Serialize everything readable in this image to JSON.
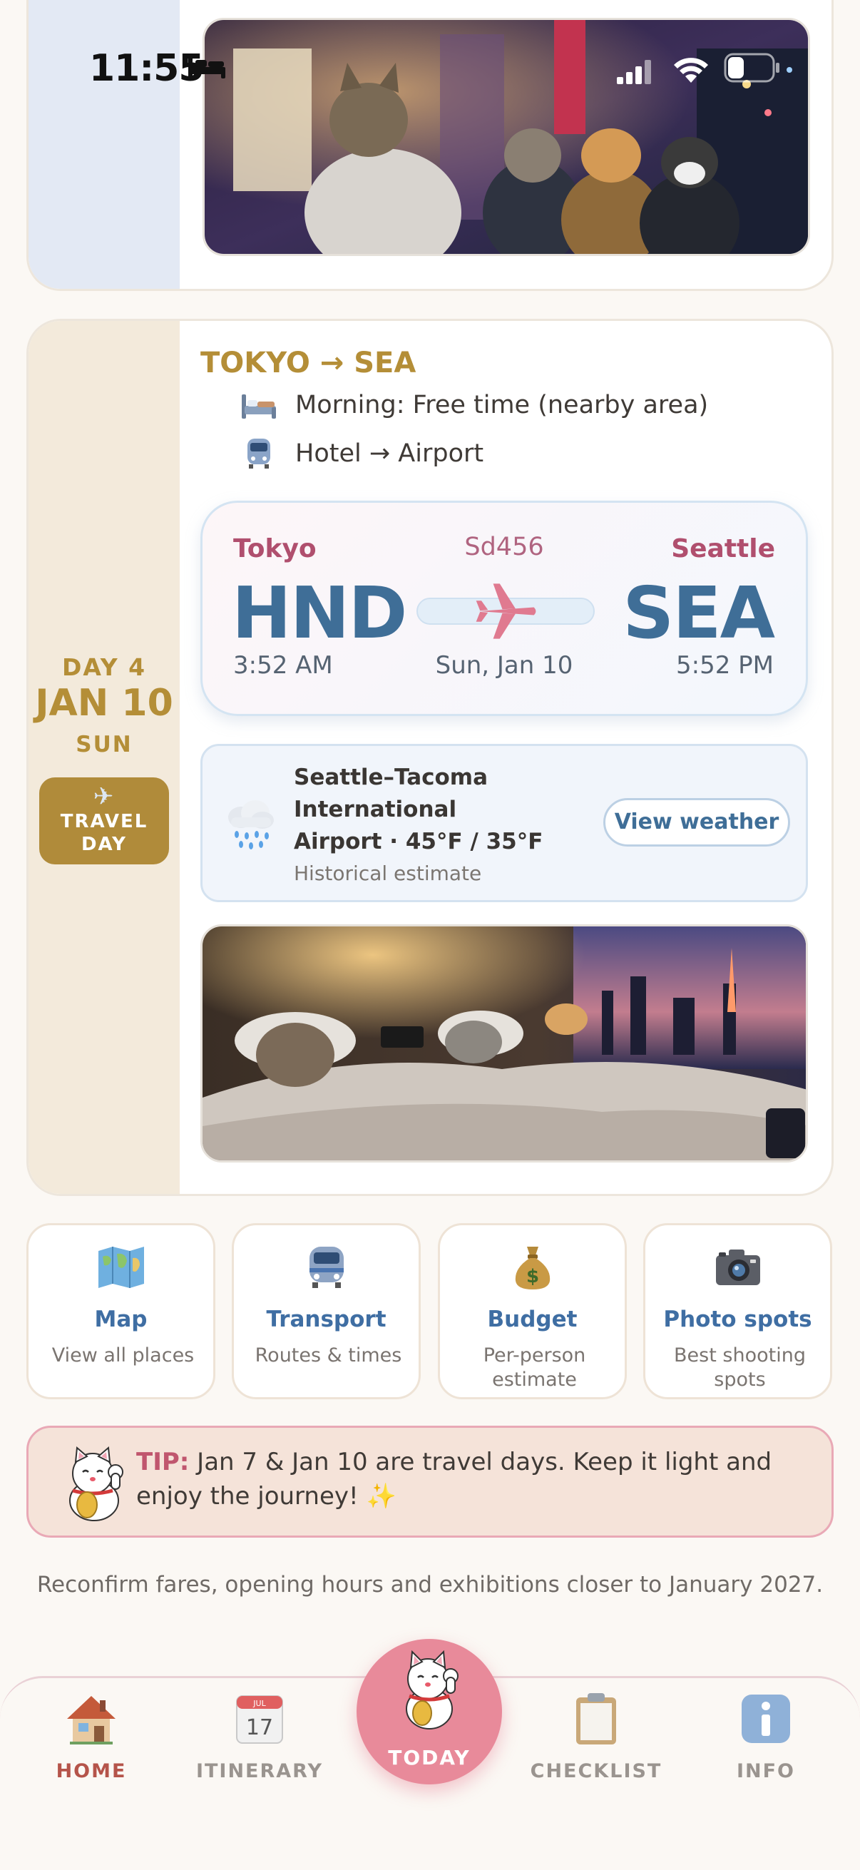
{
  "status": {
    "time": "11:55"
  },
  "trip_day": {
    "day": "DAY 4",
    "date": "JAN 10",
    "weekday": "SUN",
    "badge": "TRAVEL DAY",
    "route_title": "TOKYO → SEA",
    "activities": [
      {
        "icon": "bed-icon",
        "text": "Morning: Free time (nearby area)"
      },
      {
        "icon": "train-icon",
        "text": "Hotel → Airport"
      }
    ],
    "flight": {
      "from_city": "Tokyo",
      "from_code": "HND",
      "from_time": "3:52 AM",
      "to_city": "Seattle",
      "to_code": "SEA",
      "to_time": "5:52 PM",
      "number": "Sd456",
      "date": "Sun, Jan 10"
    },
    "weather": {
      "location": "Seattle–Tacoma International Airport · 45°F / 35°F",
      "note": "Historical estimate",
      "button": "View weather",
      "icon": "rain-cloud-icon"
    }
  },
  "quick_links": [
    {
      "icon": "map-icon",
      "title": "Map",
      "subtitle": "View all places"
    },
    {
      "icon": "train-icon",
      "title": "Transport",
      "subtitle": "Routes & times"
    },
    {
      "icon": "money-bag-icon",
      "title": "Budget",
      "subtitle": "Per-person estimate"
    },
    {
      "icon": "camera-icon",
      "title": "Photo spots",
      "subtitle": "Best shooting spots"
    }
  ],
  "tip": {
    "label": "TIP:",
    "text": " Jan 7 & Jan 10 are travel days. Keep it light and enjoy the journey! ✨"
  },
  "footer_note": "Reconfirm fares, opening hours and exhibitions closer to January 2027.",
  "nav": {
    "home": "HOME",
    "itinerary": "ITINERARY",
    "today": "TODAY",
    "checklist": "CHECKLIST",
    "info": "INFO",
    "calendar_month": "JUL",
    "calendar_day": "17"
  },
  "colors": {
    "accent_gold": "#b48e37",
    "flight_blue": "#3f6e97",
    "rose": "#e88a9a",
    "tip_red": "#c0566e"
  }
}
